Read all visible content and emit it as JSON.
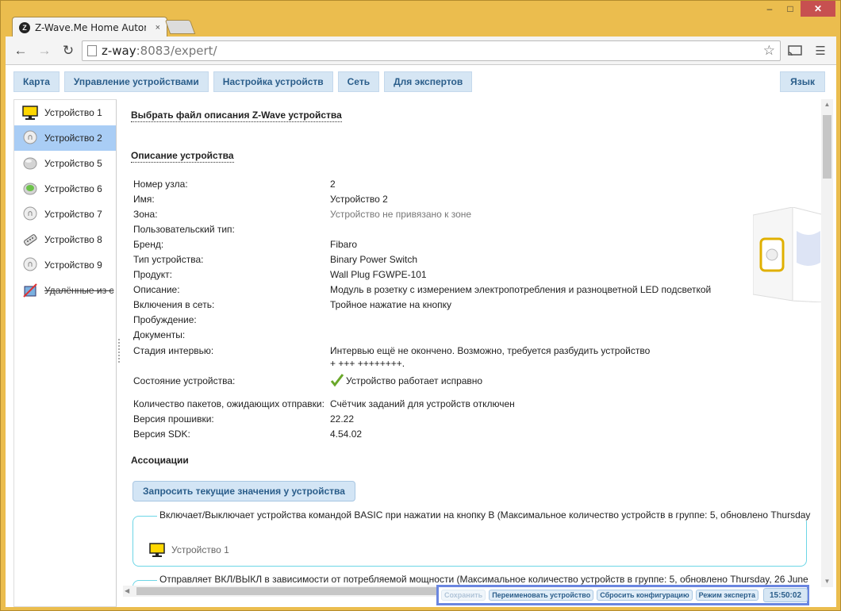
{
  "browser": {
    "tab_title": "Z-Wave.Me Home Autom",
    "tab_favicon": "Z",
    "tab_close": "×",
    "url_host": "z-way",
    "url_rest": ":8083/expert/",
    "window_controls": {
      "minimize": "–",
      "maximize": "□",
      "close": "✕"
    }
  },
  "nav": {
    "tabs": [
      "Карта",
      "Управление устройствами",
      "Настройка устройств",
      "Сеть",
      "Для экспертов"
    ],
    "language": "Язык"
  },
  "sidebar": {
    "items": [
      {
        "label": "Устройство 1",
        "icon": "monitor-icon",
        "active": false
      },
      {
        "label": "Устройство 2",
        "icon": "bulb-icon",
        "active": true
      },
      {
        "label": "Устройство 5",
        "icon": "gray-sphere-icon",
        "active": false
      },
      {
        "label": "Устройство 6",
        "icon": "green-sphere-icon",
        "active": false
      },
      {
        "label": "Устройство 7",
        "icon": "bulb-icon",
        "active": false
      },
      {
        "label": "Устройство 8",
        "icon": "remote-icon",
        "active": false
      },
      {
        "label": "Устройство 9",
        "icon": "bulb-icon",
        "active": false
      },
      {
        "label": "Удалённые из с",
        "icon": "deleted-icon",
        "active": false,
        "strikethrough": true
      }
    ]
  },
  "main": {
    "select_file_title": "Выбрать файл описания Z-Wave устройства",
    "description_title": "Описание устройства",
    "fields": [
      {
        "key": "Номер узла:",
        "value": "2"
      },
      {
        "key": "Имя:",
        "value": "Устройство 2"
      },
      {
        "key": "Зона:",
        "value": "Устройство не привязано к зоне",
        "muted": true
      },
      {
        "key": "Пользовательский тип:",
        "value": ""
      },
      {
        "key": "Бренд:",
        "value": "Fibaro"
      },
      {
        "key": "Тип устройства:",
        "value": "Binary Power Switch"
      },
      {
        "key": "Продукт:",
        "value": "Wall Plug FGWPE-101"
      },
      {
        "key": "Описание:",
        "value": "Модуль в розетку с измерением электропотребления и разноцветной LED подсветкой"
      },
      {
        "key": "Включения в сеть:",
        "value": "Тройное нажатие на кнопку"
      },
      {
        "key": "Пробуждение:",
        "value": ""
      },
      {
        "key": "Документы:",
        "value": ""
      }
    ],
    "interview": {
      "key": "Стадия интервью:",
      "line1": "Интервью ещё не окончено. Возможно, требуется разбудить устройство",
      "line2": "+ +++ ++++++++."
    },
    "status": {
      "key": "Состояние устройства:",
      "value": "Устройство работает исправно"
    },
    "fields2": [
      {
        "key": "Количество пакетов, ожидающих отправки:",
        "value": "Счётчик заданий для устройств отключен"
      },
      {
        "key": "Версия прошивки:",
        "value": "22.22"
      },
      {
        "key": "Версия SDK:",
        "value": "4.54.02"
      }
    ],
    "associations_title": "Ассоциации",
    "request_button": "Запросить текущие значения у устройства",
    "group1_legend": "Включает/Выключает устройства командой BASIC при нажатии на кнопку B (Максимальное количество устройств в группе: 5, обновлено Thursday",
    "group1_item": "Устройство 1",
    "group2_legend": "Отправляет ВКЛ/ВЫКЛ в зависимости от потребляемой мощности (Максимальное количество устройств в группе: 5, обновлено Thursday, 26 June"
  },
  "bottombar": {
    "save": "Сохранить",
    "rename": "Переименовать устройство",
    "reset": "Сбросить конфигурацию",
    "expert_mode": "Режим эксперта",
    "clock": "15:50:02"
  },
  "colors": {
    "accent": "#2a5d8a",
    "active_row": "#a9cdf5",
    "frame": "#ebbd4e"
  }
}
